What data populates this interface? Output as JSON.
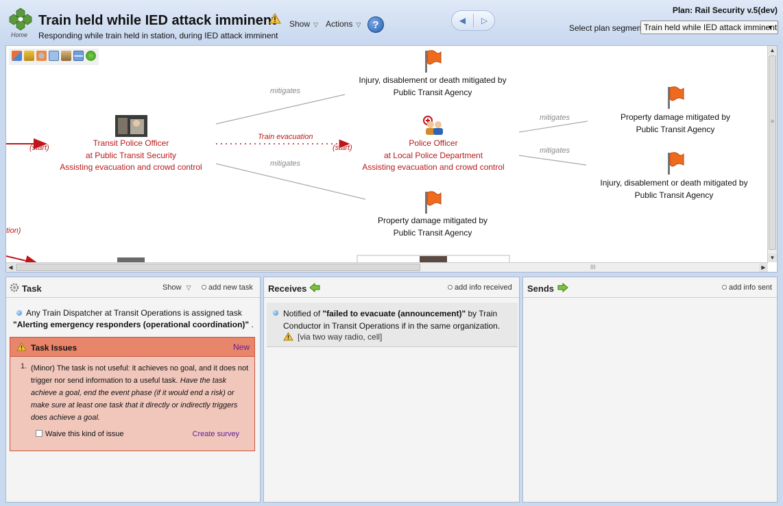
{
  "header": {
    "home_label": "Home",
    "title": "Train held while IED attack imminent",
    "subtitle": "Responding while train held in station, during IED attack imminent",
    "show_menu": "Show",
    "actions_menu": "Actions",
    "help": "?",
    "plan_label": "Plan: Rail Security v.5(dev)",
    "segment_label": "Select plan segment:",
    "segment_value": "Train held while IED attack imminent"
  },
  "flow": {
    "left_actor": {
      "line1": "Transit Police Officer",
      "line2": "at Public Transit Security",
      "line3": "Assisting evacuation and crowd control"
    },
    "center_actor": {
      "line1": "Police Officer",
      "line2": "at Local Police Department",
      "line3": "Assisting evacuation and crowd control"
    },
    "start_left": "(start)",
    "start_center": "(start)",
    "partial_left": "tion)",
    "flow_label": "Train evacuation",
    "mitigates_1": "mitigates",
    "mitigates_2": "mitigates",
    "mitigates_3": "mitigates",
    "mitigates_4": "mitigates",
    "goal_top": {
      "line1": "Injury, disablement or death mitigated by",
      "line2": "Public Transit Agency"
    },
    "goal_bottom": {
      "line1": "Property damage mitigated by",
      "line2": "Public Transit Agency"
    },
    "goal_right_top": {
      "line1": "Property damage mitigated by",
      "line2": "Public Transit Agency"
    },
    "goal_right_bottom": {
      "line1": "Injury, disablement or death mitigated by",
      "line2": "Public Transit Agency"
    },
    "hscroll_grip": "III",
    "vscroll_grip": "≡"
  },
  "task_panel": {
    "title": "Task",
    "show": "Show",
    "add_new_task": "add new task",
    "assign_text": "Any Train Dispatcher at Transit Operations is assigned task",
    "task_name": "\"Alerting emergency responders (operational coordination)\"",
    "task_name_suffix": " .",
    "issues_title": "Task Issues",
    "issues_new": "New",
    "issue_num": "1.",
    "issue_plain": "(Minor) The task is not useful: it achieves no goal, and it does not trigger nor send information to a useful task.",
    "issue_italic": "Have the task achieve a goal, end the event phase (if it would end a risk) or make sure at least one task that it directly or indirectly triggers does achieve a goal.",
    "waive_label": "Waive this kind of issue",
    "create_survey": "Create survey"
  },
  "receives_panel": {
    "title": "Receives",
    "add_info_received": "add info received",
    "notified_prefix": "Notified of",
    "info_name": "\"failed to evacuate (announcement)\"",
    "notified_suffix": "by Train Conductor in Transit Operations if in the same organization.",
    "via": "[via two way radio, cell]"
  },
  "sends_panel": {
    "title": "Sends",
    "add_info_sent": "add info sent"
  },
  "colors": {
    "header_bg": "#c8d8ef",
    "actor_red": "#b8191a",
    "issues_bg": "#f1c7bc",
    "issues_head": "#e9856a",
    "link_purple": "#5a1d9c"
  }
}
